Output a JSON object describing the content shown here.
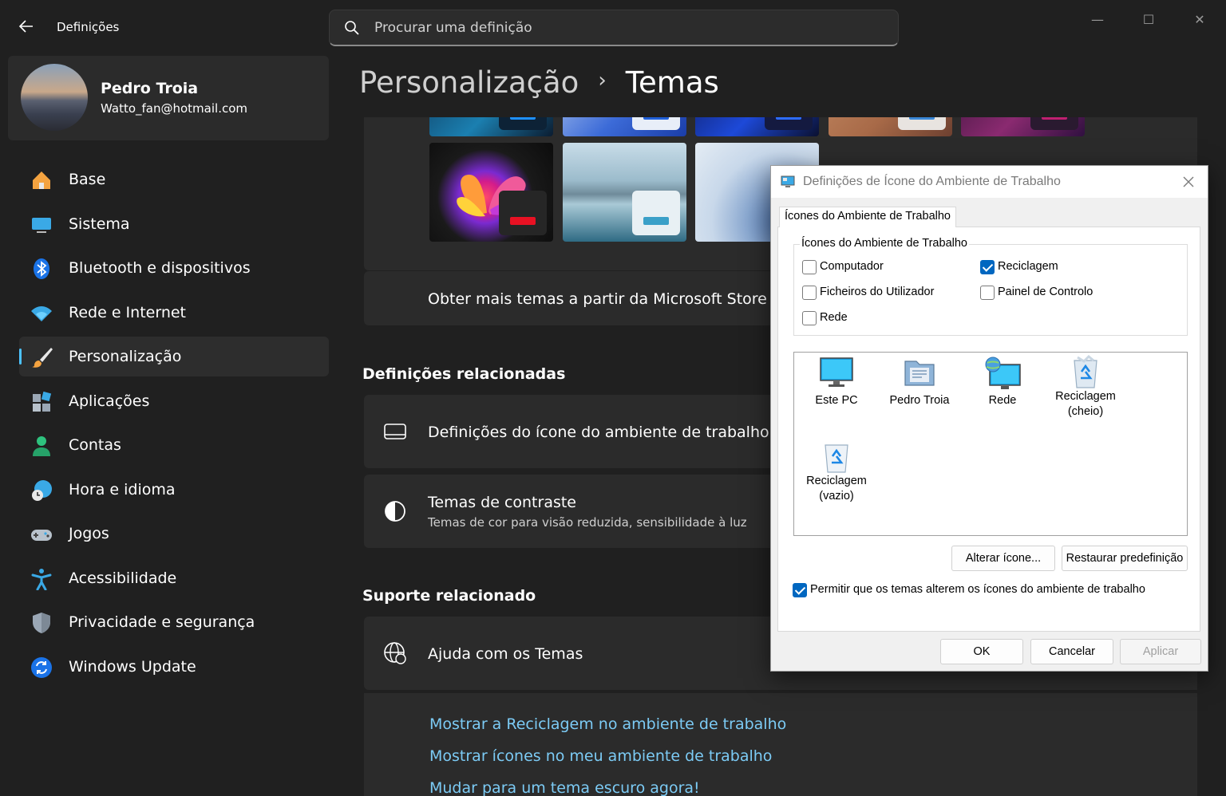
{
  "window": {
    "title": "Definições",
    "minimize": "—",
    "maximize": "☐",
    "close": "✕"
  },
  "search": {
    "placeholder": "Procurar uma definição"
  },
  "profile": {
    "name": "Pedro Troia",
    "email": "Watto_fan@hotmail.com"
  },
  "sidebar": {
    "items": [
      {
        "label": "Base",
        "icon": "home-icon"
      },
      {
        "label": "Sistema",
        "icon": "monitor-icon"
      },
      {
        "label": "Bluetooth e dispositivos",
        "icon": "bluetooth-icon"
      },
      {
        "label": "Rede e Internet",
        "icon": "wifi-icon"
      },
      {
        "label": "Personalização",
        "icon": "brush-icon",
        "active": true
      },
      {
        "label": "Aplicações",
        "icon": "apps-icon"
      },
      {
        "label": "Contas",
        "icon": "person-icon"
      },
      {
        "label": "Hora e idioma",
        "icon": "globe-clock-icon"
      },
      {
        "label": "Jogos",
        "icon": "gamepad-icon"
      },
      {
        "label": "Acessibilidade",
        "icon": "accessibility-icon"
      },
      {
        "label": "Privacidade e segurança",
        "icon": "shield-icon"
      },
      {
        "label": "Windows Update",
        "icon": "update-icon"
      }
    ]
  },
  "breadcrumb": {
    "parent": "Personalização",
    "separator": "›",
    "current": "Temas"
  },
  "main": {
    "store_link": "Obter mais temas a partir da Microsoft Store",
    "related_settings_title": "Definições relacionadas",
    "desktop_icon_settings": "Definições do ícone do ambiente de trabalho",
    "contrast_title": "Temas de contraste",
    "contrast_desc": "Temas de cor para visão reduzida, sensibilidade à luz",
    "related_support_title": "Suporte relacionado",
    "help_themes": "Ajuda com os Temas",
    "links": [
      "Mostrar a Reciclagem no ambiente de trabalho",
      "Mostrar ícones no meu ambiente de trabalho",
      "Mudar para um tema escuro agora!"
    ]
  },
  "dialog": {
    "title": "Definições de Ícone do Ambiente de Trabalho",
    "tab": "Ícones do Ambiente de Trabalho",
    "group_title": "Ícones do Ambiente de Trabalho",
    "checkboxes": [
      {
        "label": "Computador",
        "checked": false
      },
      {
        "label": "Reciclagem",
        "checked": true
      },
      {
        "label": "Ficheiros do Utilizador",
        "checked": false
      },
      {
        "label": "Painel de Controlo",
        "checked": false
      },
      {
        "label": "Rede",
        "checked": false
      }
    ],
    "icons": [
      {
        "line1": "Este PC",
        "line2": ""
      },
      {
        "line1": "Pedro Troia",
        "line2": ""
      },
      {
        "line1": "Rede",
        "line2": ""
      },
      {
        "line1": "Reciclagem",
        "line2": "(cheio)"
      },
      {
        "line1": "Reciclagem",
        "line2": "(vazio)"
      }
    ],
    "change_icon": "Alterar ícone...",
    "restore_default": "Restaurar predefinição",
    "allow_themes": "Permitir que os temas alterem os ícones do ambiente de trabalho",
    "allow_themes_checked": true,
    "ok": "OK",
    "cancel": "Cancelar",
    "apply": "Aplicar"
  },
  "colors": {
    "accent": "#4cc2ff",
    "link": "#7ccbf5",
    "dialog_accent": "#0067c0",
    "background": "#202020",
    "card": "#2b2b2b"
  }
}
